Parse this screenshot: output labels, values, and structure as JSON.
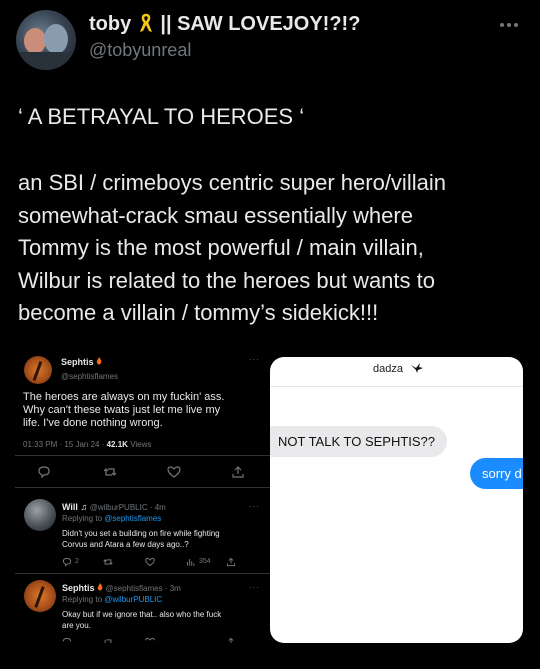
{
  "main_tweet": {
    "display_name_prefix": "toby",
    "display_name_suffix": "|| SAW LOVEJOY!?!?",
    "handle": "@tobyunreal",
    "ribbon_icon": "yellow-ribbon-icon",
    "title": "‘ A BETRAYAL TO HEROES ‘",
    "body_lines": [
      "an SBI / crimeboys centric super hero/villain",
      "somewhat-crack smau essentially where",
      "Tommy is the most powerful / main villain,",
      "Wilbur is related to the heroes but wants to",
      "become a villain / tommy’s sidekick!!!"
    ]
  },
  "screenshot_tweets": {
    "first": {
      "name": "Sephtis",
      "handle": "@sephtisflames",
      "text_lines": [
        "The heroes are always on my fuckin' ass.",
        "Why can't these twats just let me live my",
        "life. I've done nothing wrong."
      ],
      "time": "01:33 PM · 15 Jan 24 · ",
      "views_count": "42.1K",
      "views_label": " Views"
    },
    "reply1": {
      "name": "Will",
      "handle": "@wilburPUBLIC · 4m",
      "replying_prefix": "Replying to ",
      "replying_to": "@sephtisflames",
      "text_lines": [
        "Didn't you set a building on fire while fighting",
        "Corvus and Atara a few days ago..?"
      ],
      "reply_count": "2",
      "view_count": "354"
    },
    "reply2": {
      "name": "Sephtis",
      "handle": "@sephtisflames · 3m",
      "replying_prefix": "Replying to ",
      "replying_to": "@wilburPUBLIC",
      "text_lines": [
        "Okay but if we ignore that.. also who the fuck",
        "are you."
      ]
    }
  },
  "chat": {
    "contact_name": "dadza",
    "contact_icon": "bird-icon",
    "received_message": "NOT TALK TO SEPHTIS??",
    "sent_message": "sorry d"
  },
  "colors": {
    "background": "#000000",
    "text": "#e7e9ea",
    "muted": "#71767b",
    "link": "#1d9bf0",
    "bubble_blue": "#1a8cff",
    "bubble_grey": "#e9e9eb"
  }
}
